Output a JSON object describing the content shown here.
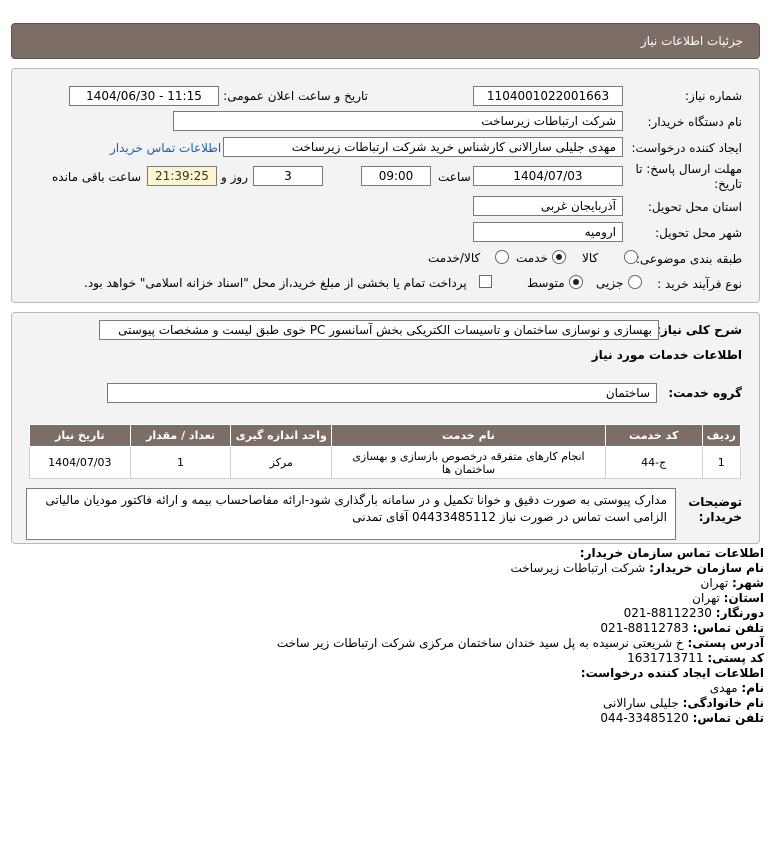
{
  "header": {
    "title": "جزئیات اطلاعات نیاز"
  },
  "need_info": {
    "need_number_label": "شماره نیاز:",
    "need_number": "1104001022001663",
    "announce_label": "تاریخ و ساعت اعلان عمومی:",
    "announce_value": "1404/06/30 - 11:15",
    "buyer_org_label": "نام دستگاه خریدار:",
    "buyer_org": "شرکت ارتباطات زیرساخت",
    "creator_label": "ایجاد کننده درخواست:",
    "creator": "مهدی جلیلی سارالانی کارشناس خرید شرکت ارتباطات زیرساخت",
    "contact_link": "اطلاعات تماس خریدار",
    "deadline_label_1": "مهلت ارسال پاسخ: تا",
    "deadline_label_2": "تاریخ:",
    "deadline_date": "1404/07/03",
    "time_label": "ساعت",
    "deadline_time": "09:00",
    "days_value": "3",
    "days_label": "روز و",
    "remaining_time": "21:39:25",
    "remaining_label": "ساعت باقی مانده",
    "province_label": "استان محل تحویل:",
    "province": "آذربایجان غربی",
    "city_label": "شهر محل تحویل:",
    "city": "ارومیه",
    "category_label": "طبقه بندی موضوعی:",
    "category_options": [
      "کالا",
      "خدمت",
      "کالا/خدمت"
    ],
    "category_selected": "خدمت",
    "process_label": "نوع فرآیند خرید :",
    "process_options": [
      "جزیی",
      "متوسط"
    ],
    "process_selected": "متوسط",
    "treasury_note": "پرداخت تمام یا بخشی از مبلغ خرید،از محل \"اسناد خزانه اسلامی\" خواهد بود."
  },
  "details": {
    "description_label": "شرح کلی نیاز:",
    "description": "بهسازی و نوسازی ساختمان و تاسیسات الکتریکی بخش آسانسور PC خوی طبق لیست و مشخصات پیوستی",
    "services_heading": "اطلاعات خدمات مورد نیاز",
    "service_group_label": "گروه خدمت:",
    "service_group": "ساختمان",
    "table": {
      "headers": [
        "ردیف",
        "کد خدمت",
        "نام خدمت",
        "واحد اندازه گیری",
        "تعداد / مقدار",
        "تاریخ نیاز"
      ],
      "rows": [
        [
          "1",
          "ج-44",
          "انجام کارهای متفرقه درخصوص بازسازی و بهسازی ساختمان ها",
          "مرکز",
          "1",
          "1404/07/03"
        ]
      ]
    },
    "buyer_notes_label_1": "توضیحات",
    "buyer_notes_label_2": "خریدار:",
    "buyer_notes": "مدارک پیوستی به صورت دقیق و خوانا تکمیل و در سامانه بارگذاری شود-ارائه مفاصاحساب بیمه و ارائه فاکتور مودیان مالیاتی الزامی است تماس در صورت نیاز 04433485112 آقای تمدنی"
  },
  "buyer_contact": {
    "heading": "اطلاعات تماس سازمان خریدار:",
    "org_label": "نام سازمان خریدار:",
    "org": "شرکت ارتباطات زیرساخت",
    "city_label": "شهر:",
    "city": "تهران",
    "province_label": "استان:",
    "province": "تهران",
    "fax_label": "دورنگار:",
    "fax": "021-88112230",
    "phone_label": "تلفن تماس:",
    "phone": "021-88112783",
    "address_label": "آدرس پستی:",
    "address": "خ شریعتی نرسیده به پل سید خندان ساختمان مرکزی شرکت ارتباطات زیر ساخت",
    "postal_label": "کد پستی:",
    "postal": "1631713711",
    "creator_heading": "اطلاعات ایجاد کننده درخواست:",
    "name_label": "نام:",
    "name": "مهدی",
    "family_label": "نام خانوادگی:",
    "family": "جلیلی سارالانی",
    "creator_phone_label": "تلفن تماس:",
    "creator_phone": "044-33485120"
  }
}
